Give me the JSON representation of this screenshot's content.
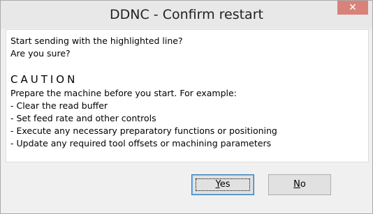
{
  "window": {
    "title": "DDNC - Confirm restart"
  },
  "message": {
    "question_line1": "Start sending with the highlighted line?",
    "question_line2": "Are you sure?",
    "caution_heading": "CAUTION",
    "caution_intro": "Prepare the machine before you start. For example:",
    "caution_items": [
      " - Clear the read buffer",
      " - Set feed rate and other controls",
      " - Execute any necessary preparatory functions or positioning",
      " - Update any required tool offsets or machining parameters"
    ]
  },
  "buttons": {
    "yes_mnemonic": "Y",
    "yes_rest": "es",
    "no_mnemonic": "N",
    "no_rest": "o"
  },
  "icons": {
    "close": "close-icon"
  },
  "colors": {
    "close_button": "#d9827a",
    "default_button_border": "#3c7fb1"
  }
}
